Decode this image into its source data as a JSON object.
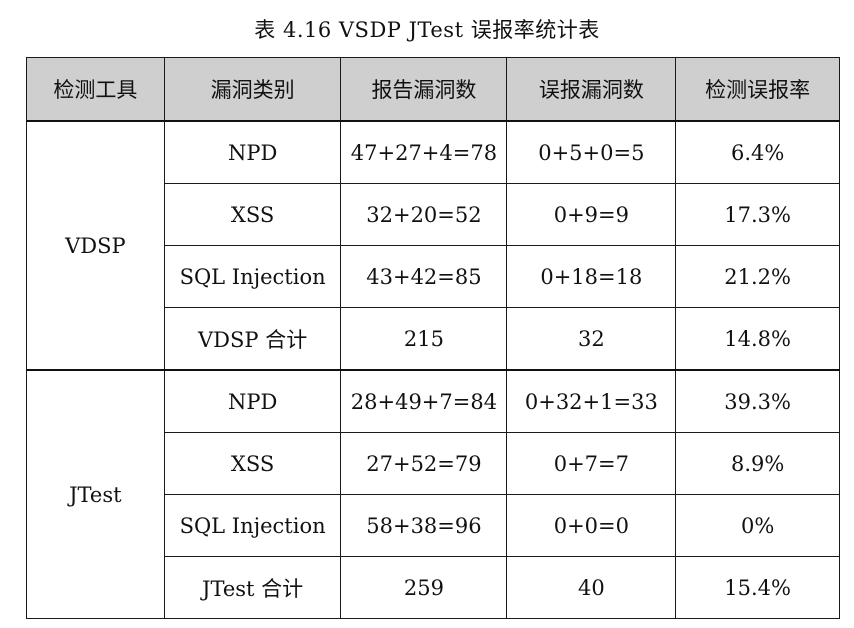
{
  "caption": "表 4.16 VSDP JTest  误报率统计表",
  "headers": [
    "检测工具",
    "漏洞类别",
    "报告漏洞数",
    "误报漏洞数",
    "检测误报率"
  ],
  "groups": [
    {
      "tool": "VDSP",
      "rows": [
        {
          "category": "NPD",
          "reported": "47+27+4=78",
          "false_reports": "0+5+0=5",
          "rate": "6.4%"
        },
        {
          "category": "XSS",
          "reported": "32+20=52",
          "false_reports": "0+9=9",
          "rate": "17.3%"
        },
        {
          "category": "SQL Injection",
          "reported": "43+42=85",
          "false_reports": "0+18=18",
          "rate": "21.2%"
        },
        {
          "category": "VDSP 合计",
          "reported": "215",
          "false_reports": "32",
          "rate": "14.8%"
        }
      ]
    },
    {
      "tool": "JTest",
      "rows": [
        {
          "category": "NPD",
          "reported": "28+49+7=84",
          "false_reports": "0+32+1=33",
          "rate": "39.3%"
        },
        {
          "category": "XSS",
          "reported": "27+52=79",
          "false_reports": "0+7=7",
          "rate": "8.9%"
        },
        {
          "category": "SQL Injection",
          "reported": "58+38=96",
          "false_reports": "0+0=0",
          "rate": "0%"
        },
        {
          "category": "JTest 合计",
          "reported": "259",
          "false_reports": "40",
          "rate": "15.4%"
        }
      ]
    }
  ]
}
